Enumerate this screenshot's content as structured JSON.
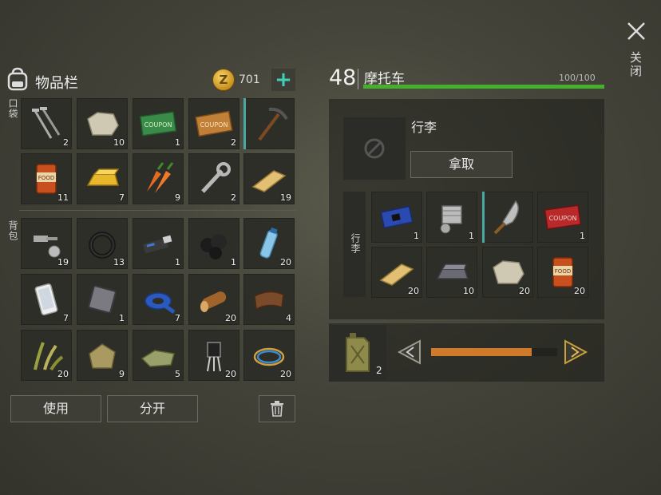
{
  "inventory": {
    "title": "物品栏",
    "currency_value": "701",
    "add_label": "+",
    "pocket_label": "口袋",
    "backpack_label": "背包",
    "pocket_items": [
      {
        "icon": "nails-icon",
        "count": "2"
      },
      {
        "icon": "stone-icon",
        "count": "10"
      },
      {
        "icon": "green-coupon-icon",
        "count": "1"
      },
      {
        "icon": "orange-coupon-icon",
        "count": "2"
      },
      {
        "icon": "pickaxe-icon",
        "count": ""
      },
      {
        "icon": "food-can-icon",
        "count": "11"
      },
      {
        "icon": "gold-bar-icon",
        "count": "7"
      },
      {
        "icon": "carrot-icon",
        "count": "9"
      },
      {
        "icon": "wrench-icon",
        "count": "2"
      },
      {
        "icon": "wood-plank-icon",
        "count": "19"
      }
    ],
    "backpack_items": [
      {
        "icon": "bolt-nut-icon",
        "count": "19"
      },
      {
        "icon": "rubber-ring-icon",
        "count": "13"
      },
      {
        "icon": "usb-drive-icon",
        "count": "1"
      },
      {
        "icon": "coal-icon",
        "count": "1"
      },
      {
        "icon": "water-bottle-icon",
        "count": "20"
      },
      {
        "icon": "smartphone-icon",
        "count": "7"
      },
      {
        "icon": "metal-plate-icon",
        "count": "1"
      },
      {
        "icon": "duct-tape-icon",
        "count": "7"
      },
      {
        "icon": "log-icon",
        "count": "20"
      },
      {
        "icon": "leather-icon",
        "count": "4"
      },
      {
        "icon": "plant-fiber-icon",
        "count": "20"
      },
      {
        "icon": "cloth-sack-icon",
        "count": "9"
      },
      {
        "icon": "fabric-scraps-icon",
        "count": "5"
      },
      {
        "icon": "transistor-icon",
        "count": "20"
      },
      {
        "icon": "wires-icon",
        "count": "20"
      }
    ],
    "use_label": "使用",
    "split_label": "分开"
  },
  "vehicle": {
    "level": "48",
    "name": "摩托车",
    "hp_text": "100/100",
    "hp_fraction": 1.0,
    "cargo_title": "行李",
    "side_label": "行李",
    "take_label": "拿取",
    "cargo_items": [
      {
        "icon": "circuit-board-icon",
        "count": "1"
      },
      {
        "icon": "engine-cylinder-icon",
        "count": "1"
      },
      {
        "icon": "machete-icon",
        "count": ""
      },
      {
        "icon": "red-coupon-icon",
        "count": "1"
      },
      {
        "icon": "wood-plank-icon",
        "count": "20"
      },
      {
        "icon": "iron-ingot-icon",
        "count": "10"
      },
      {
        "icon": "stone-icon",
        "count": "20"
      },
      {
        "icon": "food-can-icon",
        "count": "20"
      }
    ],
    "fuel_count": "2",
    "fuel_fraction": 0.8
  },
  "close_label": "关闭",
  "colors": {
    "accent": "#3fd1b8",
    "hp": "#45b02c",
    "slider": "#cf7a2a",
    "equip": "#4aa7a4"
  }
}
